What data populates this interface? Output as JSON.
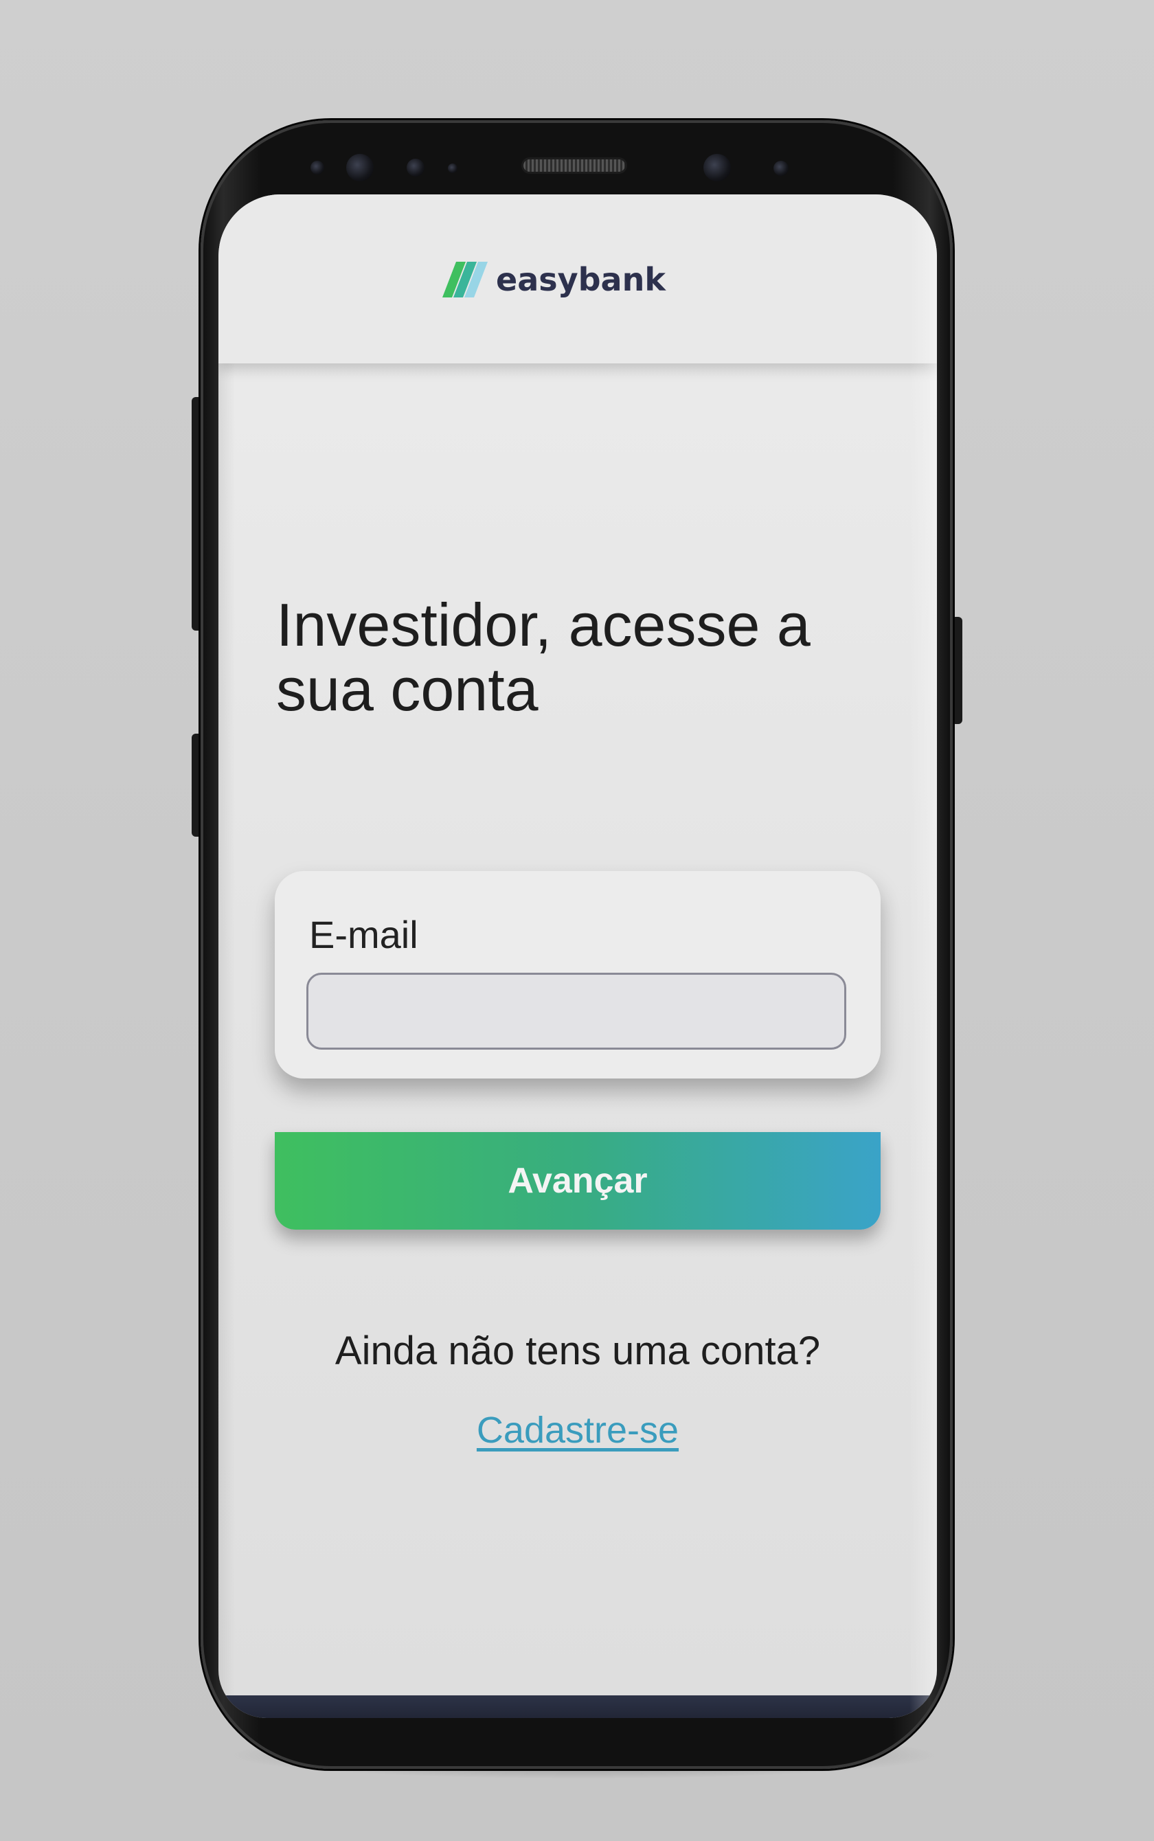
{
  "app": {
    "brand_name": "easybank",
    "brand_colors": {
      "accent_green": "#3fbf5f",
      "accent_teal": "#3aa3c8",
      "text_dark": "#2d314d"
    }
  },
  "login": {
    "title": "Investidor, acesse a sua conta",
    "email_label": "E-mail",
    "email_value": "",
    "email_placeholder": "",
    "submit_label": "Avançar",
    "signup_prompt": "Ainda não tens uma conta?",
    "signup_link": "Cadastre-se"
  },
  "icons": {
    "logo": "easybank-stripes-icon"
  }
}
